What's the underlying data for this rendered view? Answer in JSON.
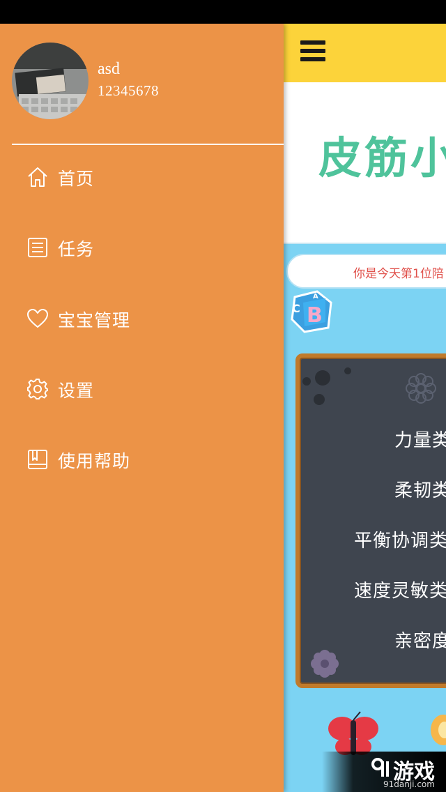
{
  "user": {
    "name": "asd",
    "id": "12345678"
  },
  "drawer_menu": [
    {
      "label": "首页",
      "icon": "home-icon"
    },
    {
      "label": "任务",
      "icon": "task-list-icon"
    },
    {
      "label": "宝宝管理",
      "icon": "heart-icon"
    },
    {
      "label": "设置",
      "icon": "gear-icon"
    },
    {
      "label": "使用帮助",
      "icon": "book-icon"
    }
  ],
  "main": {
    "banner_title": "皮筋小",
    "marquee_text": "你是今天第1位陪",
    "board_items": [
      "力量类",
      "柔韧类",
      "平衡协调类",
      "速度灵敏类",
      "亲密度"
    ]
  },
  "watermark": {
    "brand": "游戏",
    "url": "91danji.com"
  },
  "colors": {
    "drawer_bg": "#ec9347",
    "header_yellow": "#fcd33a",
    "main_bg": "#7cd3f3",
    "board_bg": "#3f454f",
    "board_frame": "#c07a2b",
    "banner_green": "#4fc39b",
    "marquee_red": "#e0514b"
  }
}
